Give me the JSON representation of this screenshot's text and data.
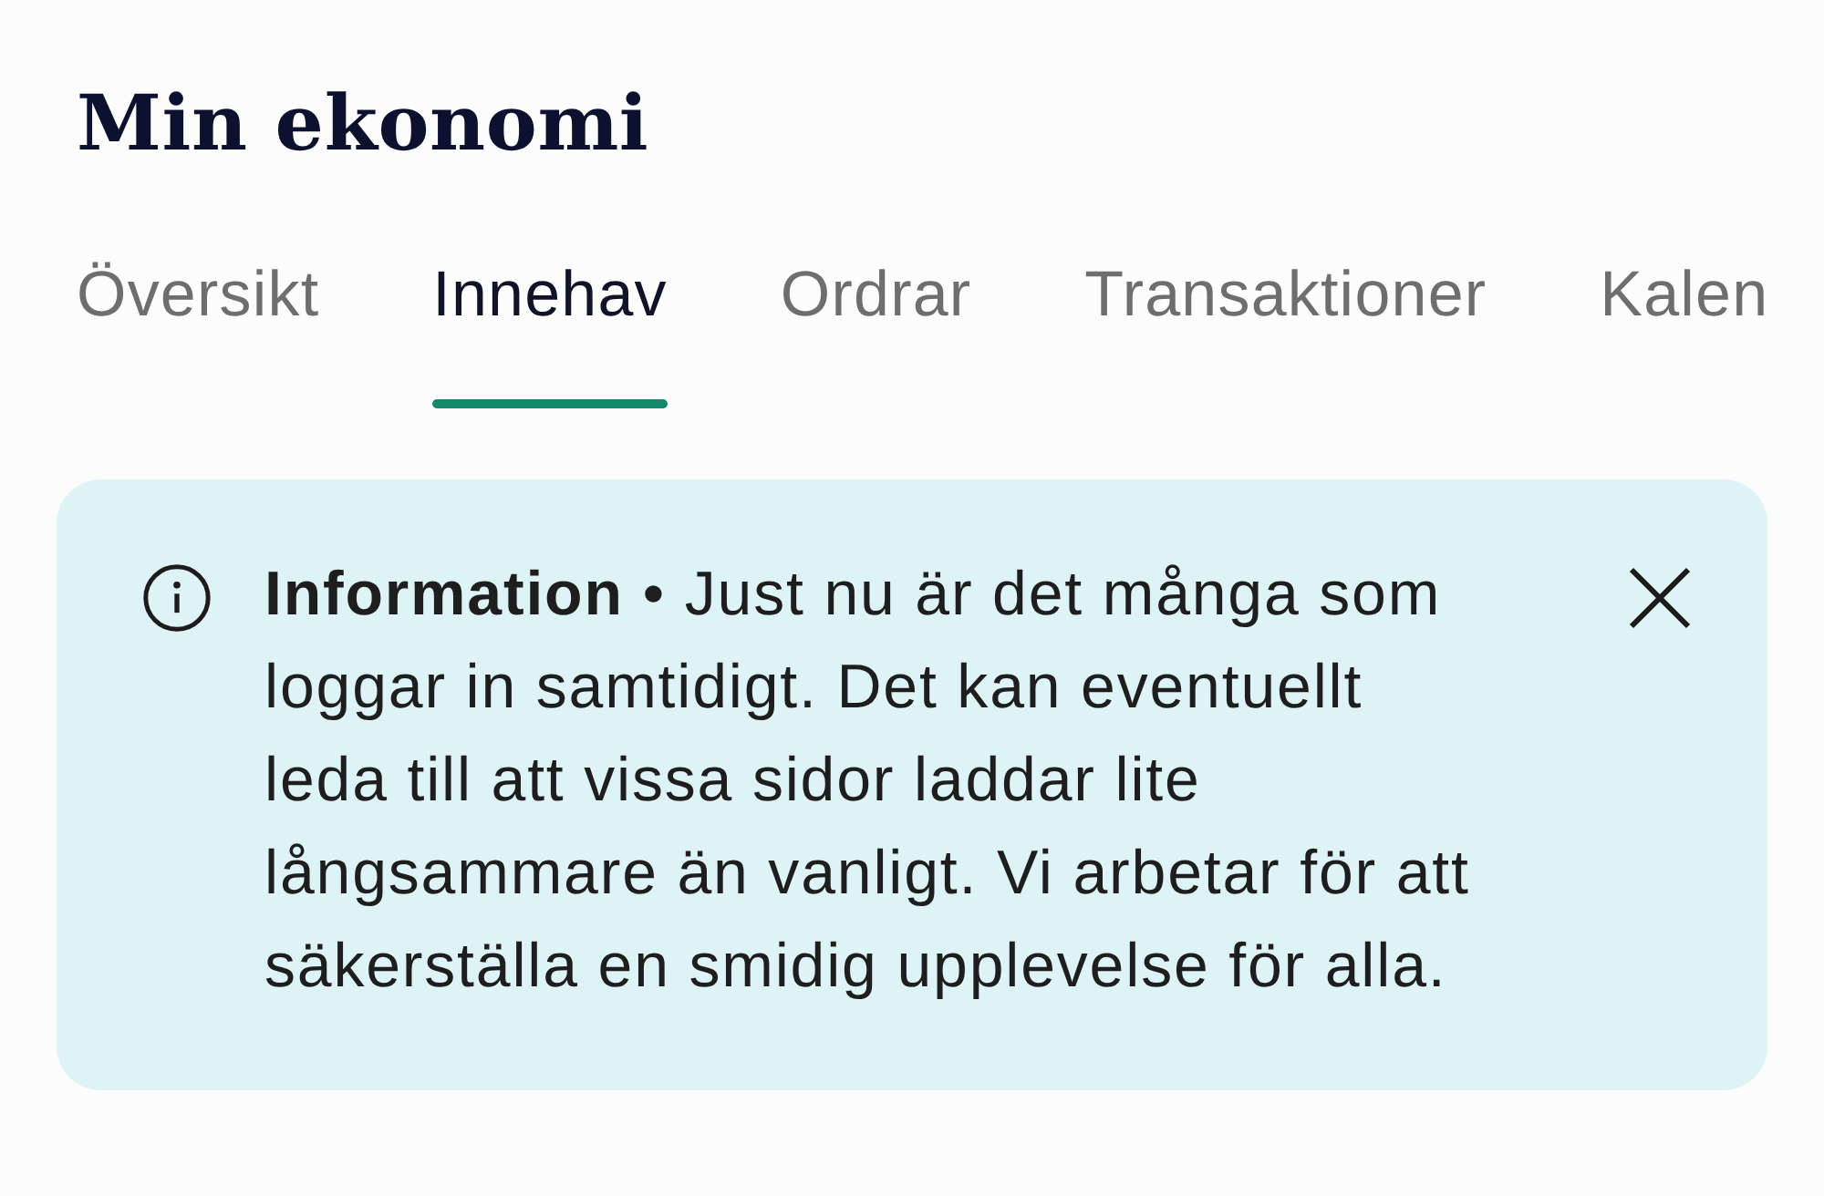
{
  "page": {
    "title": "Min ekonomi"
  },
  "tabs": [
    {
      "label": "Översikt",
      "selected": false
    },
    {
      "label": "Innehav",
      "selected": true
    },
    {
      "label": "Ordrar",
      "selected": false
    },
    {
      "label": "Transaktioner",
      "selected": false
    },
    {
      "label": "Kalen",
      "selected": false
    }
  ],
  "banner": {
    "text": "**Information** • Just nu är det många som loggar in samtidigt. Det kan eventuellt leda till att vissa sidor laddar lite långsammare än vanligt. Vi arbetar för att säkerställa en smidig upplevelse för alla."
  }
}
